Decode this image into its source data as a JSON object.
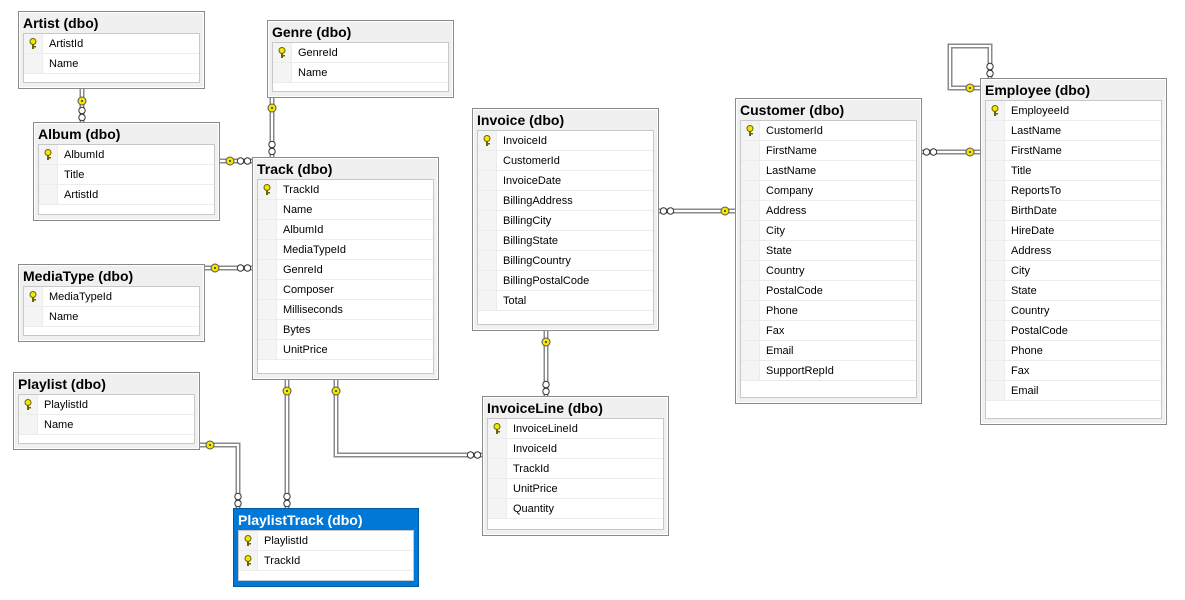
{
  "diagram": {
    "colors": {
      "selected": "#0078d7",
      "key": "#f5e600",
      "line": "#8a8a8a"
    },
    "tables": [
      {
        "id": "artist",
        "title": "Artist (dbo)",
        "columns": [
          {
            "name": "ArtistId",
            "pk": true
          },
          {
            "name": "Name"
          }
        ]
      },
      {
        "id": "genre",
        "title": "Genre (dbo)",
        "columns": [
          {
            "name": "GenreId",
            "pk": true
          },
          {
            "name": "Name"
          }
        ]
      },
      {
        "id": "album",
        "title": "Album (dbo)",
        "columns": [
          {
            "name": "AlbumId",
            "pk": true
          },
          {
            "name": "Title"
          },
          {
            "name": "ArtistId"
          }
        ]
      },
      {
        "id": "track",
        "title": "Track (dbo)",
        "columns": [
          {
            "name": "TrackId",
            "pk": true
          },
          {
            "name": "Name"
          },
          {
            "name": "AlbumId"
          },
          {
            "name": "MediaTypeId"
          },
          {
            "name": "GenreId"
          },
          {
            "name": "Composer"
          },
          {
            "name": "Milliseconds"
          },
          {
            "name": "Bytes"
          },
          {
            "name": "UnitPrice"
          }
        ]
      },
      {
        "id": "mediatype",
        "title": "MediaType (dbo)",
        "columns": [
          {
            "name": "MediaTypeId",
            "pk": true
          },
          {
            "name": "Name"
          }
        ]
      },
      {
        "id": "playlist",
        "title": "Playlist (dbo)",
        "columns": [
          {
            "name": "PlaylistId",
            "pk": true
          },
          {
            "name": "Name"
          }
        ]
      },
      {
        "id": "playlisttrack",
        "title": "PlaylistTrack (dbo)",
        "selected": true,
        "columns": [
          {
            "name": "PlaylistId",
            "pk": true
          },
          {
            "name": "TrackId",
            "pk": true
          }
        ]
      },
      {
        "id": "invoice",
        "title": "Invoice (dbo)",
        "columns": [
          {
            "name": "InvoiceId",
            "pk": true
          },
          {
            "name": "CustomerId"
          },
          {
            "name": "InvoiceDate"
          },
          {
            "name": "BillingAddress"
          },
          {
            "name": "BillingCity"
          },
          {
            "name": "BillingState"
          },
          {
            "name": "BillingCountry"
          },
          {
            "name": "BillingPostalCode"
          },
          {
            "name": "Total"
          }
        ]
      },
      {
        "id": "invoiceline",
        "title": "InvoiceLine (dbo)",
        "columns": [
          {
            "name": "InvoiceLineId",
            "pk": true
          },
          {
            "name": "InvoiceId"
          },
          {
            "name": "TrackId"
          },
          {
            "name": "UnitPrice"
          },
          {
            "name": "Quantity"
          }
        ]
      },
      {
        "id": "customer",
        "title": "Customer (dbo)",
        "columns": [
          {
            "name": "CustomerId",
            "pk": true
          },
          {
            "name": "FirstName"
          },
          {
            "name": "LastName"
          },
          {
            "name": "Company"
          },
          {
            "name": "Address"
          },
          {
            "name": "City"
          },
          {
            "name": "State"
          },
          {
            "name": "Country"
          },
          {
            "name": "PostalCode"
          },
          {
            "name": "Phone"
          },
          {
            "name": "Fax"
          },
          {
            "name": "Email"
          },
          {
            "name": "SupportRepId"
          }
        ]
      },
      {
        "id": "employee",
        "title": "Employee (dbo)",
        "columns": [
          {
            "name": "EmployeeId",
            "pk": true
          },
          {
            "name": "LastName"
          },
          {
            "name": "FirstName"
          },
          {
            "name": "Title"
          },
          {
            "name": "ReportsTo"
          },
          {
            "name": "BirthDate"
          },
          {
            "name": "HireDate"
          },
          {
            "name": "Address"
          },
          {
            "name": "City"
          },
          {
            "name": "State"
          },
          {
            "name": "Country"
          },
          {
            "name": "PostalCode"
          },
          {
            "name": "Phone"
          },
          {
            "name": "Fax"
          },
          {
            "name": "Email"
          }
        ]
      }
    ],
    "relationships": [
      {
        "one": "artist",
        "many": "album"
      },
      {
        "one": "genre",
        "many": "track"
      },
      {
        "one": "album",
        "many": "track"
      },
      {
        "one": "mediatype",
        "many": "track"
      },
      {
        "one": "playlist",
        "many": "playlisttrack"
      },
      {
        "one": "track",
        "many": "playlisttrack"
      },
      {
        "one": "track",
        "many": "invoiceline"
      },
      {
        "one": "invoice",
        "many": "invoiceline"
      },
      {
        "one": "customer",
        "many": "invoice"
      },
      {
        "one": "employee",
        "many": "customer"
      },
      {
        "one": "employee",
        "many": "employee"
      }
    ]
  }
}
